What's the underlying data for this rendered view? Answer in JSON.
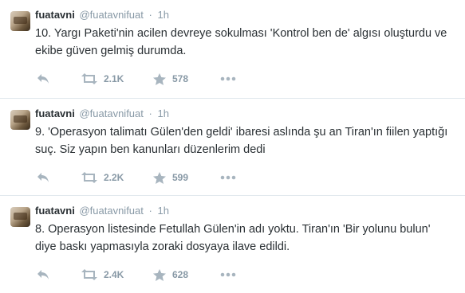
{
  "tweets": [
    {
      "name": "fuatavni",
      "handle": "@fuatavnifuat",
      "separator": "·",
      "time": "1h",
      "text": "10. Yargı Paketi'nin acilen devreye sokulması 'Kontrol ben de' algısı oluşturdu ve ekibe güven gelmiş durumda.",
      "retweets": "2.1K",
      "favorites": "578"
    },
    {
      "name": "fuatavni",
      "handle": "@fuatavnifuat",
      "separator": "·",
      "time": "1h",
      "text": "9. 'Operasyon talimatı Gülen'den geldi' ibaresi aslında şu an Tiran'ın fiilen yaptığı suç. Siz yapın ben kanunları düzenlerim dedi",
      "retweets": "2.2K",
      "favorites": "599"
    },
    {
      "name": "fuatavni",
      "handle": "@fuatavnifuat",
      "separator": "·",
      "time": "1h",
      "text": "8. Operasyon listesinde Fetullah Gülen'in adı yoktu. Tiran'ın 'Bir yolunu bulun' diye baskı yapmasıyla zoraki dosyaya ilave edildi.",
      "retweets": "2.4K",
      "favorites": "628"
    }
  ],
  "icons": {
    "reply": "reply-icon",
    "retweet": "retweet-icon",
    "favorite": "star-icon",
    "more": "more-dots-icon"
  },
  "colors": {
    "text": "#292f33",
    "muted": "#8899a6",
    "divider": "#e1e8ed"
  }
}
